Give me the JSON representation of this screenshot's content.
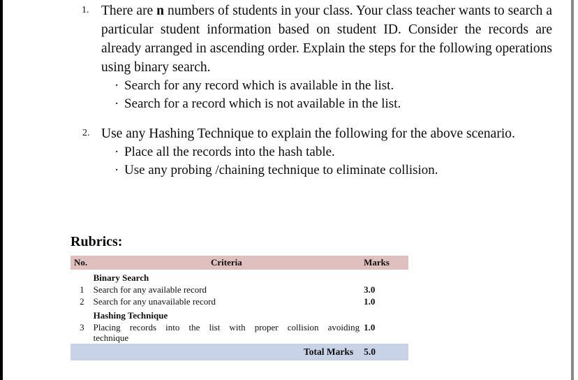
{
  "document": {
    "questions": [
      {
        "number": "1.",
        "text_before_bold": "There are ",
        "bold_token": "n",
        "text_after_bold": " numbers of students in your class.  Your class teacher wants to search a particular student information based on student ID.   Consider the records are already arranged in ascending order. Explain the steps for the following operations using binary search.",
        "bullets": [
          "Search for any record which is available in the list.",
          "Search for a record which is not available in the list."
        ]
      },
      {
        "number": "2.",
        "text": "Use any Hashing Technique to explain the following for the above scenario.",
        "bullets": [
          "Place all the records into the hash table.",
          "Use any probing /chaining technique to eliminate collision."
        ]
      }
    ],
    "bullet_glyph": "·",
    "rubrics_heading": "Rubrics:",
    "rubrics_table": {
      "headers": {
        "no": "No.",
        "criteria": "Criteria",
        "marks": "Marks"
      },
      "sections": [
        {
          "title": "Binary Search",
          "rows": [
            {
              "no": "1",
              "criteria": "Search for any available record",
              "marks": "3.0"
            },
            {
              "no": "2",
              "criteria": "Search for any unavailable record",
              "marks": "1.0"
            }
          ]
        },
        {
          "title": "Hashing Technique",
          "rows": [
            {
              "no": "3",
              "criteria": "Placing records into the list with proper collision avoiding",
              "criteria_line2": "technique",
              "marks": "1.0"
            }
          ]
        }
      ],
      "total": {
        "label": "Total Marks",
        "value": "5.0"
      },
      "colors": {
        "header_background": "#e0bfbf",
        "total_background": "#c8d3e8"
      }
    }
  }
}
